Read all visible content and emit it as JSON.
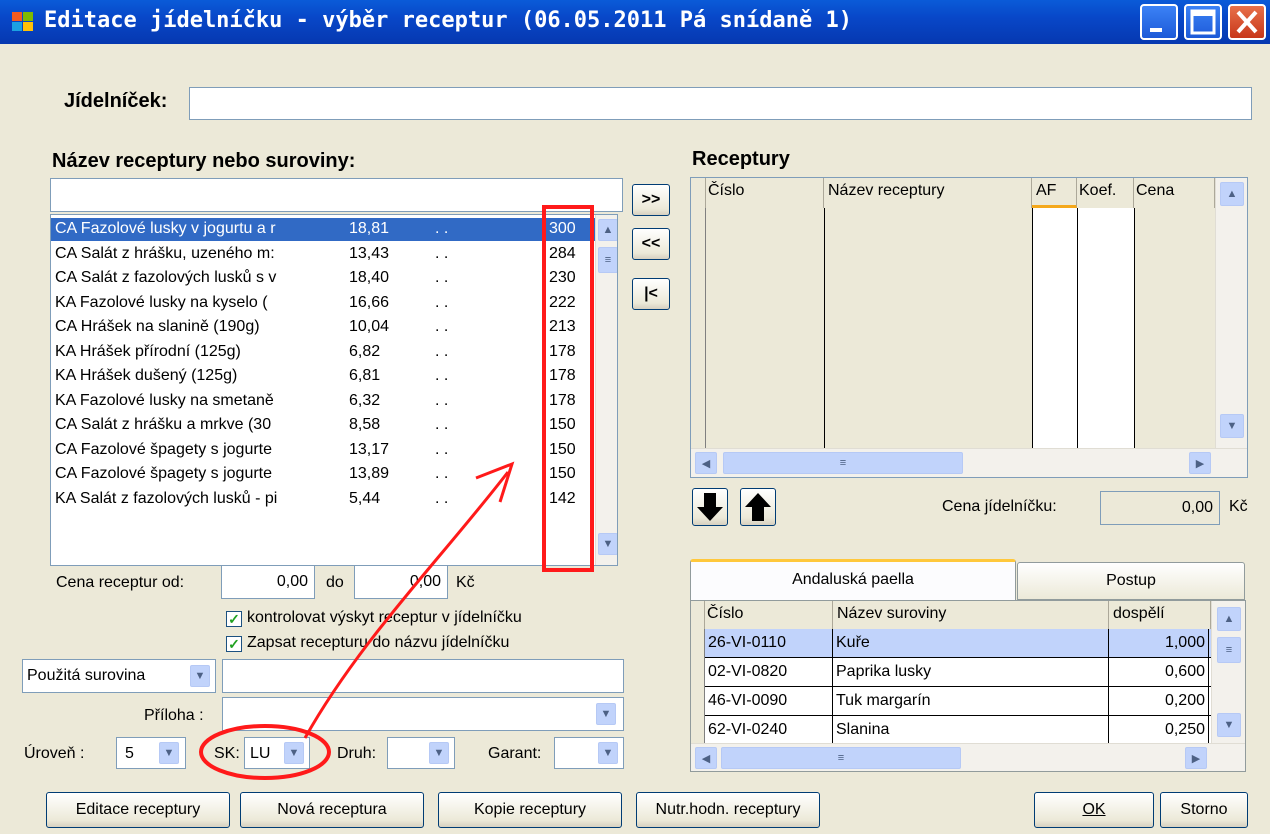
{
  "window": {
    "title": "Editace jídelníčku - výběr receptur (06.05.2011 Pá snídaně 1)",
    "minimize": "_",
    "maximize": "□",
    "close": "X"
  },
  "jidelnicek": {
    "label": "Jídelníček:",
    "value": ""
  },
  "search": {
    "label": "Název receptury nebo suroviny:",
    "value": ""
  },
  "recipe_list": {
    "rows": [
      {
        "name": "CA Fazolové lusky v jogurtu a r",
        "price": "18,81",
        "dots": ". .",
        "count": "300"
      },
      {
        "name": "CA Salát z hrášku, uzeného m:",
        "price": "13,43",
        "dots": ". .",
        "count": "284"
      },
      {
        "name": "CA Salát z fazolových lusků s v",
        "price": "18,40",
        "dots": ". .",
        "count": "230"
      },
      {
        "name": "KA Fazolové lusky na kyselo (",
        "price": "16,66",
        "dots": ". .",
        "count": "222"
      },
      {
        "name": "CA Hrášek na slanině (190g)",
        "price": "10,04",
        "dots": ". .",
        "count": "213"
      },
      {
        "name": "KA Hrášek přírodní (125g)",
        "price": "6,82",
        "dots": ". .",
        "count": "178"
      },
      {
        "name": "KA Hrášek dušený (125g)",
        "price": "6,81",
        "dots": ". .",
        "count": "178"
      },
      {
        "name": "KA Fazolové lusky na smetaně",
        "price": "6,32",
        "dots": ". .",
        "count": "178"
      },
      {
        "name": "CA Salát z hrášku a mrkve (30",
        "price": "8,58",
        "dots": ". .",
        "count": "150"
      },
      {
        "name": "CA Fazolové špagety s jogurte",
        "price": "13,17",
        "dots": ". .",
        "count": "150"
      },
      {
        "name": "CA Fazolové špagety s jogurte",
        "price": "13,89",
        "dots": ". .",
        "count": "150"
      },
      {
        "name": "KA Salát z fazolových lusků - pi",
        "price": "5,44",
        "dots": ". .",
        "count": "142"
      }
    ],
    "selected_index": 0
  },
  "transfer": {
    "add": ">>",
    "remove": "<<",
    "first": "|<"
  },
  "receptury": {
    "title": "Receptury",
    "columns": [
      "Číslo",
      "Název receptury",
      "AF",
      "Koef.",
      "Cena"
    ]
  },
  "cena_jidelnicku": {
    "label": "Cena jídelníčku:",
    "value": "0,00",
    "unit": "Kč"
  },
  "cena_filter": {
    "label": "Cena receptur od:",
    "from": "0,00",
    "do_label": "do",
    "to": "0,00",
    "unit": "Kč"
  },
  "checks": {
    "kontrolovat": {
      "label": "kontrolovat výskyt receptur v jídelníčku",
      "checked": true
    },
    "zapsat": {
      "label": "Zapsat recepturu do názvu jídelníčku",
      "checked": true
    }
  },
  "surovina": {
    "select": "Použitá surovina",
    "value": ""
  },
  "priloha": {
    "label": "Příloha :",
    "value": ""
  },
  "uroven": {
    "label": "Úroveň :",
    "value": "5"
  },
  "sk": {
    "label": "SK:",
    "value": "LU"
  },
  "druh": {
    "label": "Druh:",
    "value": ""
  },
  "garant": {
    "label": "Garant:",
    "value": ""
  },
  "tabs": {
    "active": "Andaluská paella",
    "other": "Postup"
  },
  "ingredients": {
    "columns": [
      "Číslo",
      "Název suroviny",
      "dospělí"
    ],
    "rows": [
      {
        "code": "26-VI-0110",
        "name": "Kuře",
        "qty": "1,000"
      },
      {
        "code": "02-VI-0820",
        "name": "Paprika lusky",
        "qty": "0,600"
      },
      {
        "code": "46-VI-0090",
        "name": "Tuk margarín",
        "qty": "0,200"
      },
      {
        "code": "62-VI-0240",
        "name": "Slanina",
        "qty": "0,250"
      }
    ]
  },
  "buttons": {
    "editace": "Editace receptury",
    "nova": "Nová receptura",
    "kopie": "Kopie receptury",
    "nutr": "Nutr.hodn. receptury",
    "ok": "OK",
    "storno": "Storno"
  },
  "colors": {
    "titlebar": "#0a5bd8",
    "selection": "#316ac5",
    "annotation": "#ff0000",
    "window_bg": "#ece9d8"
  }
}
